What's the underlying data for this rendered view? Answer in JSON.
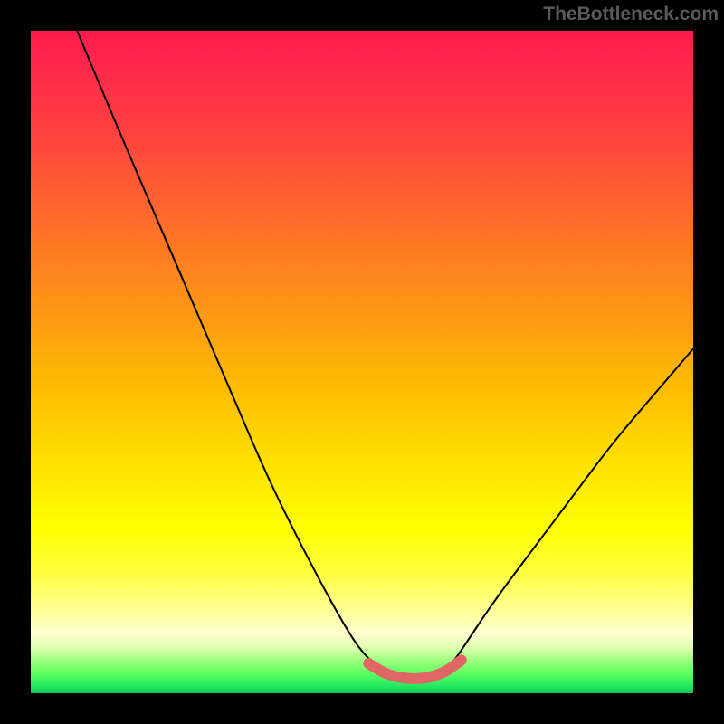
{
  "watermark": "TheBottleneck.com",
  "chart_data": {
    "type": "line",
    "title": "",
    "xlabel": "",
    "ylabel": "",
    "xlim": [
      0,
      100
    ],
    "ylim": [
      0,
      100
    ],
    "axes_visible": false,
    "background_gradient_top_color": "#ff1a4d",
    "background_gradient_bottom_color": "#0fc45a",
    "series": [
      {
        "name": "bottleneck-curve",
        "color": "#000000",
        "x": [
          7,
          12,
          18,
          24,
          30,
          36,
          42,
          48,
          51,
          54,
          56,
          58,
          60,
          62,
          64,
          66,
          70,
          76,
          82,
          88,
          94,
          100
        ],
        "y": [
          100,
          88,
          74,
          60,
          46,
          32,
          20,
          9,
          5,
          3,
          2,
          2,
          2,
          3,
          5,
          8,
          14,
          22,
          30,
          38,
          45,
          52
        ]
      },
      {
        "name": "optimal-band",
        "color": "#e06666",
        "x": [
          51,
          53,
          55,
          57,
          59,
          61,
          63,
          65
        ],
        "y": [
          4.5,
          3.2,
          2.5,
          2.2,
          2.2,
          2.6,
          3.5,
          5.0
        ]
      }
    ]
  }
}
